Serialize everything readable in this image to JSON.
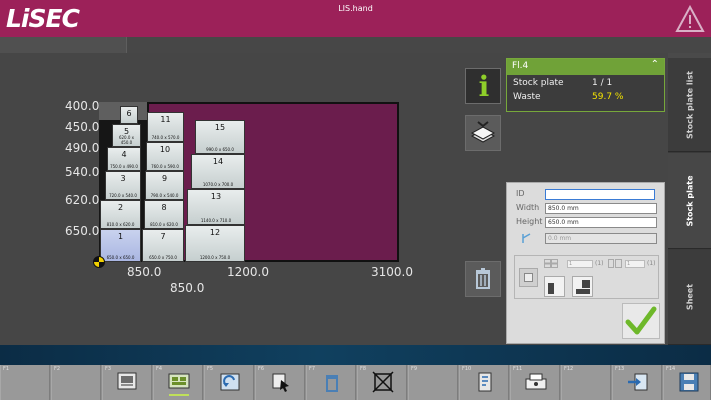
{
  "header": {
    "logo": "LiSEC",
    "title": "LIS.hand"
  },
  "drawing": {
    "y_labels": [
      "400.0",
      "450.0",
      "490.0",
      "540.0",
      "620.0",
      "650.0"
    ],
    "x_labels": [
      "850.0",
      "1200.0",
      "3100.0"
    ],
    "x_label_below": "850.0",
    "pieces": [
      {
        "n": "1",
        "d": "650.0 x 650.0"
      },
      {
        "n": "2",
        "d": "810.0 x 620.0"
      },
      {
        "n": "3",
        "d": "720.0 x 540.0"
      },
      {
        "n": "4",
        "d": "750.0 x 490.0"
      },
      {
        "n": "5",
        "d": "620.0 x 450.0"
      },
      {
        "n": "6",
        "d": ""
      },
      {
        "n": "7",
        "d": "650.0 x 750.0"
      },
      {
        "n": "8",
        "d": "810.0 x 620.0"
      },
      {
        "n": "9",
        "d": "790.0 x 540.0"
      },
      {
        "n": "10",
        "d": "760.0 x 590.0"
      },
      {
        "n": "11",
        "d": "740.0 x 570.0"
      },
      {
        "n": "12",
        "d": "1200.0 x 750.0"
      },
      {
        "n": "13",
        "d": "1140.0 x 710.0"
      },
      {
        "n": "14",
        "d": "1070.0 x 700.0"
      },
      {
        "n": "15",
        "d": "990.0 x 650.0"
      }
    ]
  },
  "info_panel": {
    "title": "Fl.4",
    "rows": [
      {
        "label": "Stock plate",
        "value": "1 / 1",
        "color": "#f0f0f0"
      },
      {
        "label": "Waste",
        "value": "59.7 %",
        "color": "#f5e400"
      }
    ]
  },
  "tabs": [
    "Stock plate list",
    "Stock plate",
    "Sheet"
  ],
  "dialog": {
    "id_label": "ID",
    "id_value": "",
    "width_label": "Width",
    "width_value": "850.0 mm",
    "height_label": "Height",
    "height_value": "650.0 mm",
    "angle_value": "0.0 mm",
    "count_a": "(1)",
    "count_b": "(1)",
    "mini_a": "1",
    "mini_b": "1"
  },
  "fkeys": [
    "F1",
    "F2",
    "F3",
    "F4",
    "F5",
    "F6",
    "F7",
    "F8",
    "F9",
    "F10",
    "F11",
    "F12",
    "F13",
    "F14"
  ],
  "colors": {
    "header": "#9c2159",
    "waste": "#6b1d4d",
    "accent": "#70a238",
    "warning": "#f5e400"
  }
}
